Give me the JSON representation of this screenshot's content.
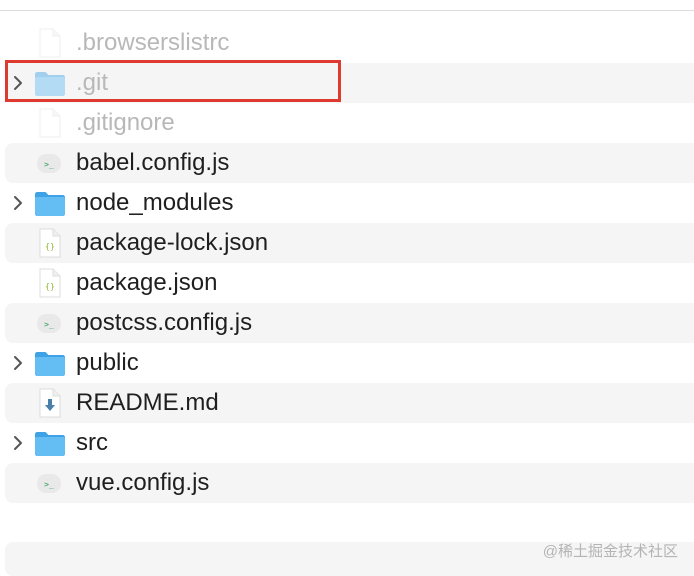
{
  "files": [
    {
      "name": ".browserslistrc",
      "kind": "file",
      "icon": "document-icon",
      "hidden": true,
      "expandable": false,
      "stripe": false
    },
    {
      "name": ".git",
      "kind": "folder",
      "icon": "folder-icon",
      "hidden": true,
      "expandable": true,
      "stripe": true,
      "highlighted": true
    },
    {
      "name": ".gitignore",
      "kind": "file",
      "icon": "document-icon",
      "hidden": true,
      "expandable": false,
      "stripe": false
    },
    {
      "name": "babel.config.js",
      "kind": "file",
      "icon": "javascript-file-icon",
      "hidden": false,
      "expandable": false,
      "stripe": true
    },
    {
      "name": "node_modules",
      "kind": "folder",
      "icon": "folder-icon",
      "hidden": false,
      "expandable": true,
      "stripe": false
    },
    {
      "name": "package-lock.json",
      "kind": "file",
      "icon": "json-file-icon",
      "hidden": false,
      "expandable": false,
      "stripe": true
    },
    {
      "name": "package.json",
      "kind": "file",
      "icon": "json-file-icon",
      "hidden": false,
      "expandable": false,
      "stripe": false
    },
    {
      "name": "postcss.config.js",
      "kind": "file",
      "icon": "javascript-file-icon",
      "hidden": false,
      "expandable": false,
      "stripe": true
    },
    {
      "name": "public",
      "kind": "folder",
      "icon": "folder-icon",
      "hidden": false,
      "expandable": true,
      "stripe": false
    },
    {
      "name": "README.md",
      "kind": "file",
      "icon": "markdown-file-icon",
      "hidden": false,
      "expandable": false,
      "stripe": true
    },
    {
      "name": "src",
      "kind": "folder",
      "icon": "folder-icon",
      "hidden": false,
      "expandable": true,
      "stripe": false
    },
    {
      "name": "vue.config.js",
      "kind": "file",
      "icon": "javascript-file-icon",
      "hidden": false,
      "expandable": false,
      "stripe": true
    }
  ],
  "watermark": "@稀土掘金技术社区",
  "colors": {
    "highlight_border": "#de3a30",
    "stripe": "#f5f5f5",
    "folder": "#59b5f0",
    "text": "#1f1f1f",
    "hidden_text": "#b8b8b8"
  }
}
